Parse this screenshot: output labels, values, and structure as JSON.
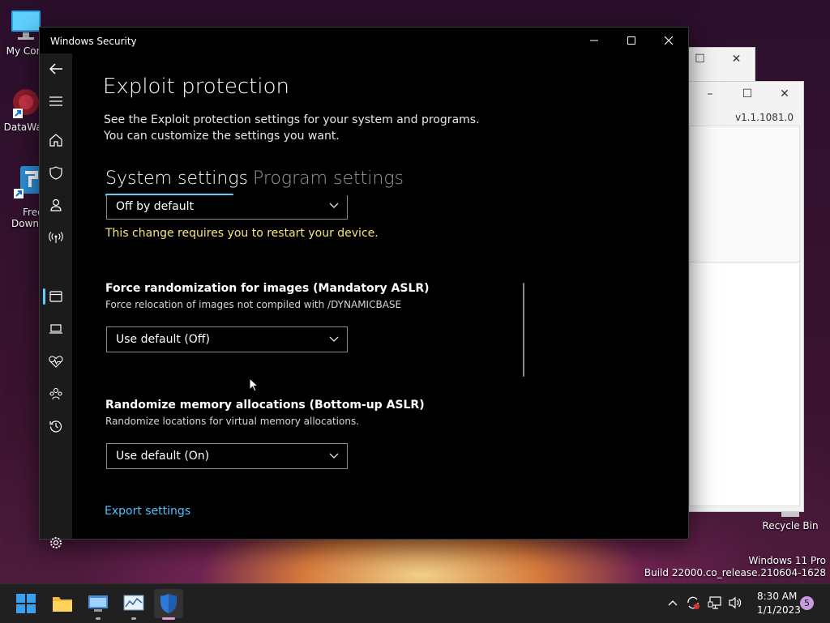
{
  "desktop": {
    "icons": [
      {
        "label": "My Com"
      },
      {
        "label": "DataWag"
      },
      {
        "label": "Free"
      },
      {
        "label": "Downl"
      },
      {
        "label": "Recycle Bin"
      }
    ],
    "watermark_line1": "Windows 11 Pro",
    "watermark_line2": "Build 22000.co_release.210604-1628"
  },
  "background_window": {
    "version": "v1.1.1081.0"
  },
  "window": {
    "title": "Windows Security",
    "heading": "Exploit protection",
    "description": "See the Exploit protection settings for your system and programs.  You can customize the settings you want.",
    "tabs": [
      {
        "label": "System settings",
        "selected": true
      },
      {
        "label": "Program settings",
        "selected": false
      }
    ],
    "top_dropdown_value": "Off by default",
    "restart_warning": "This change requires you to restart your device.",
    "sections": [
      {
        "title": "Force randomization for images (Mandatory ASLR)",
        "description": "Force relocation of images not compiled with /DYNAMICBASE",
        "dropdown_value": "Use default (Off)"
      },
      {
        "title": "Randomize memory allocations (Bottom-up ASLR)",
        "description": "Randomize locations for virtual memory allocations.",
        "dropdown_value": "Use default (On)"
      }
    ],
    "export_link": "Export settings",
    "nav_icons": [
      "back-arrow-icon",
      "hamburger-menu-icon",
      "home-icon",
      "shield-icon",
      "account-icon",
      "firewall-network-icon",
      "app-browser-control-icon",
      "device-security-icon",
      "device-health-icon",
      "family-options-icon",
      "protection-history-icon",
      "settings-gear-icon"
    ],
    "selected_nav": "app-browser-control-icon"
  },
  "taskbar": {
    "time": "8:30 AM",
    "date": "1/1/2023",
    "notification_count": "5"
  },
  "colors": {
    "accent": "#60cdff",
    "link": "#4cc2ff",
    "warning": "#f4e77a"
  }
}
